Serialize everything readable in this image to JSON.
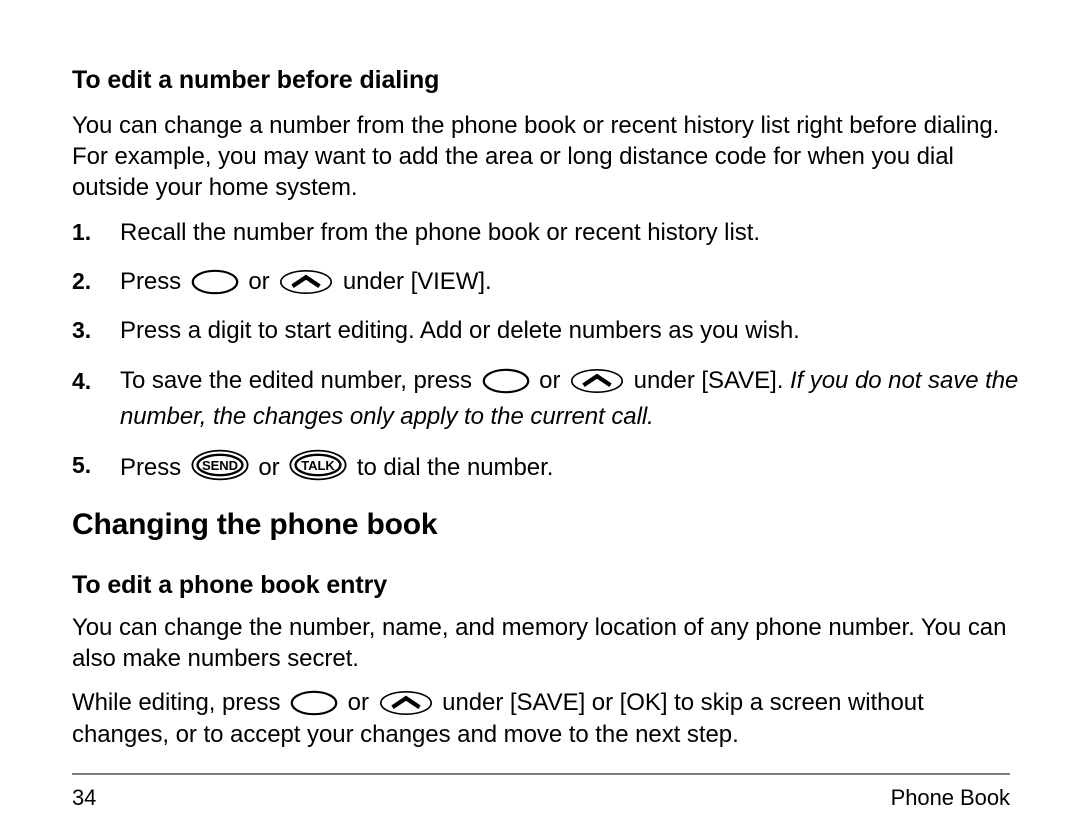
{
  "page": {
    "number": "34",
    "running_head": "Phone Book"
  },
  "sections": [
    {
      "heading": "To edit a number before dialing",
      "intro": "You can change a number from the phone book or recent history list right before dialing. For example, you may want to add the area or long distance code for when you dial outside your home system.",
      "steps": [
        {
          "num": "1.",
          "text": "Recall the number from the phone book or recent history list."
        },
        {
          "num": "2.",
          "pre": "Press ",
          "mid": " or ",
          "post": " under [VIEW].",
          "keys": [
            "softkey-blank",
            "navkey-up"
          ]
        },
        {
          "num": "3.",
          "text": "Press a digit to start editing. Add or delete numbers as you wish."
        },
        {
          "num": "4.",
          "pre": "To save the edited number, press ",
          "mid": " or ",
          "post": " under [SAVE]. ",
          "italic": "If you do not save the number, the changes only apply to the current call.",
          "keys": [
            "softkey-blank",
            "navkey-up"
          ]
        },
        {
          "num": "5.",
          "pre": "Press ",
          "mid": " or ",
          "post": " to dial the number.",
          "keys": [
            "send-key",
            "talk-key"
          ],
          "key_labels": [
            "SEND",
            "TALK"
          ]
        }
      ]
    },
    {
      "heading": "Changing the phone book",
      "subheading": "To edit a phone book entry",
      "intro": "You can change the number, name, and memory location of any phone number. You can also make numbers secret.",
      "note": {
        "pre": "While editing, press ",
        "mid": " or ",
        "post": " under [SAVE] or [OK] to skip a screen without changes, or to accept your changes and move to the next step.",
        "keys": [
          "softkey-blank",
          "navkey-up"
        ]
      }
    }
  ],
  "colors": {
    "text": "#000000",
    "rule": "#7d7d7d",
    "background": "#ffffff"
  }
}
